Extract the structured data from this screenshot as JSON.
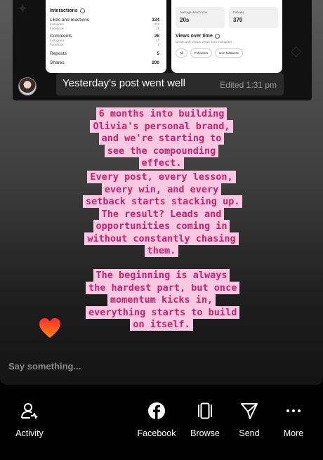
{
  "chat": {
    "left_card": {
      "section_title": "Interactions",
      "rows": [
        {
          "label": "Likes and reactions",
          "value": "334",
          "sub": [
            [
              "Instagram",
              "315"
            ],
            [
              "Facebook",
              "19"
            ]
          ]
        },
        {
          "label": "Comments",
          "value": "28",
          "sub": [
            [
              "Instagram",
              "27"
            ],
            [
              "Facebook",
              "1"
            ]
          ]
        },
        {
          "label": "Reposts",
          "value": "5",
          "sub": []
        },
        {
          "label": "Shares",
          "value": "200",
          "sub": []
        }
      ]
    },
    "right_card": {
      "stats": [
        {
          "label": "Average watch time",
          "value": "20s"
        },
        {
          "label": "Follows",
          "value": "370"
        }
      ],
      "section_title": "Views over time",
      "note": "Graph only shows views from Instagram",
      "chips": [
        "All",
        "Followers",
        "Non-followers"
      ]
    },
    "message_text": "Yesterday's post went well",
    "message_meta": "Edited 1:31 pm"
  },
  "captions": {
    "block1": "6 months into building Olivia's personal brand, and we're starting to see the compounding effect.",
    "block2": "Every post, every lesson, every win, and every setback starts stacking up. The result? Leads and opportunities coming in without constantly chasing them.",
    "block3": "The beginning is always the hardest part, but once momentum kicks in, everything starts to build on itself."
  },
  "reply": {
    "placeholder": "Say something..."
  },
  "nav": [
    {
      "label": "Activity",
      "icon": "activity-icon"
    },
    {
      "label": "Facebook",
      "icon": "facebook-icon"
    },
    {
      "label": "Browse",
      "icon": "browse-icon"
    },
    {
      "label": "Send",
      "icon": "send-icon"
    },
    {
      "label": "More",
      "icon": "more-icon"
    }
  ],
  "colors": {
    "caption_text": "#c4226a",
    "caption_bg": "#f9c8e3",
    "heart": "#ff4a1c"
  }
}
